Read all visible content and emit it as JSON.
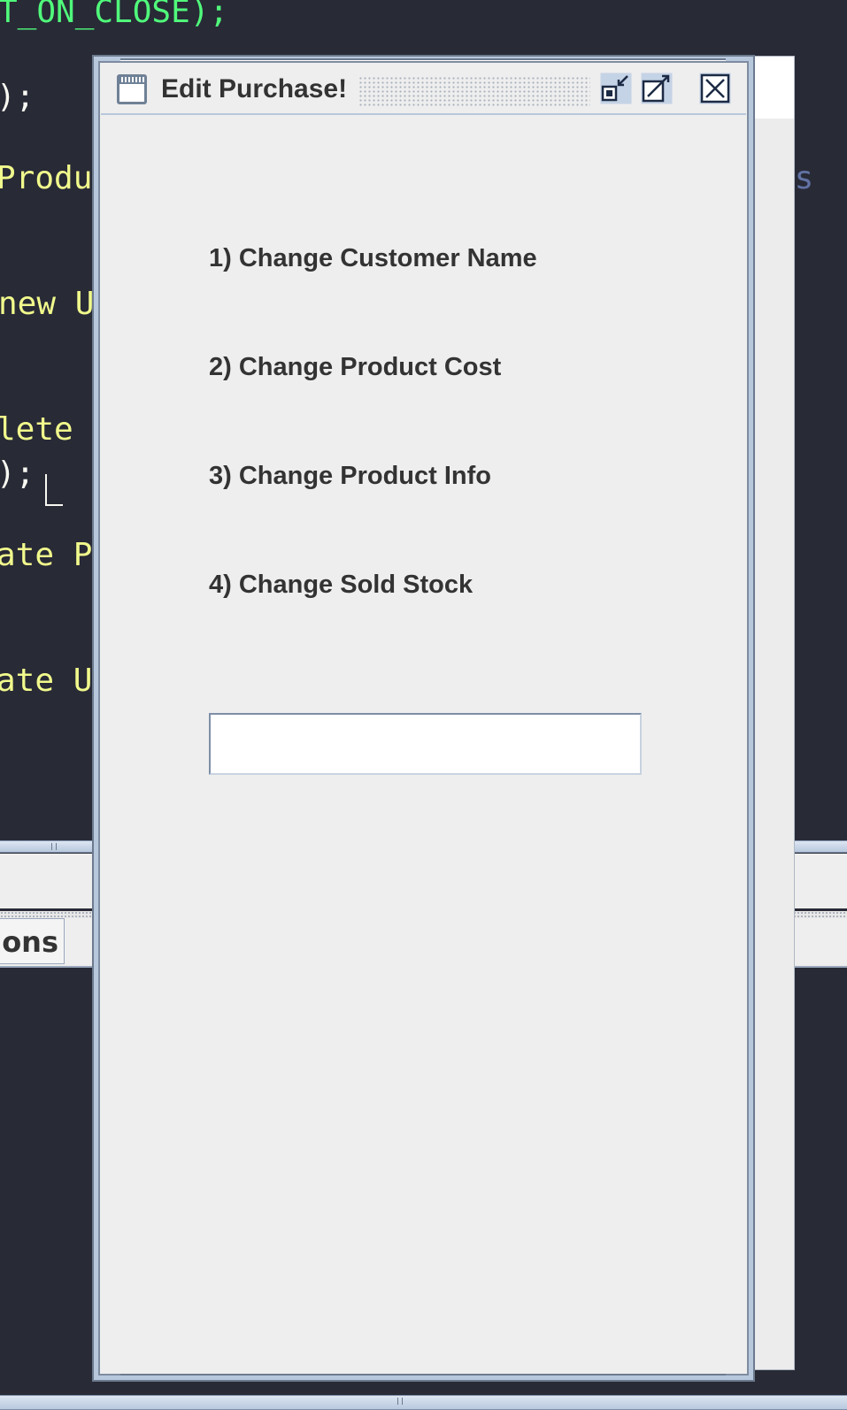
{
  "background_editor": {
    "lines": [
      {
        "text": "T_ON_CLOSE);"
      },
      {
        "text": ");"
      },
      {
        "text": "Produc",
        "trailing": "cs"
      },
      {
        "text": "new Us"
      },
      {
        "text": "lete U"
      },
      {
        "text": ");"
      },
      {
        "text": "ate Pr"
      },
      {
        "text": "ate Us"
      }
    ]
  },
  "bottom_panel": {
    "tab_label": "ons"
  },
  "dialog": {
    "title": "Edit Purchase!",
    "buttons": {
      "iconify": "iconify",
      "maximize": "maximize",
      "close": "close"
    },
    "options": [
      {
        "label": "1) Change Customer Name"
      },
      {
        "label": "2) Change Product Cost"
      },
      {
        "label": "3) Change Product Info"
      },
      {
        "label": "4) Change Sold Stock"
      }
    ],
    "choice_input": {
      "value": "",
      "placeholder": ""
    }
  },
  "icons": {
    "frame": "window-icon",
    "iconify": "iconify-icon",
    "maximize": "maximize-icon",
    "close": "close-icon"
  },
  "colors": {
    "editor_background": "#282a36",
    "code_yellow": "#f1fa8c",
    "code_green": "#50fa7b",
    "frame_border": "#6c7a8e",
    "frame_background": "#eeeeee",
    "label_text": "#333333"
  }
}
